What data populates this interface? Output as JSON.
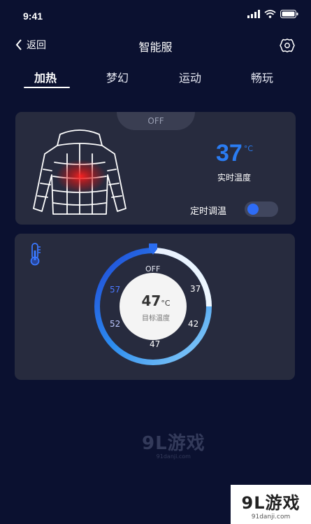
{
  "status": {
    "time": "9:41"
  },
  "nav": {
    "back_label": "返回",
    "title": "智能服"
  },
  "tabs": [
    {
      "label": "加热",
      "active": true
    },
    {
      "label": "梦幻",
      "active": false
    },
    {
      "label": "运动",
      "active": false
    },
    {
      "label": "畅玩",
      "active": false
    }
  ],
  "heating_card": {
    "power_label": "OFF",
    "temp_value": "37",
    "temp_unit": "°C",
    "temp_label": "实时温度",
    "timer_label": "定时调温",
    "timer_enabled": true
  },
  "dial": {
    "off_label": "OFF",
    "ticks": [
      "37",
      "42",
      "47",
      "52",
      "57"
    ],
    "target_value": "47",
    "target_unit": "°C",
    "target_label": "目标温度"
  },
  "watermark": {
    "brand": "9L游戏",
    "site": "91danji.com"
  },
  "colors": {
    "accent": "#2a7cf2",
    "background": "#0b1130",
    "card": "#272b3e"
  }
}
